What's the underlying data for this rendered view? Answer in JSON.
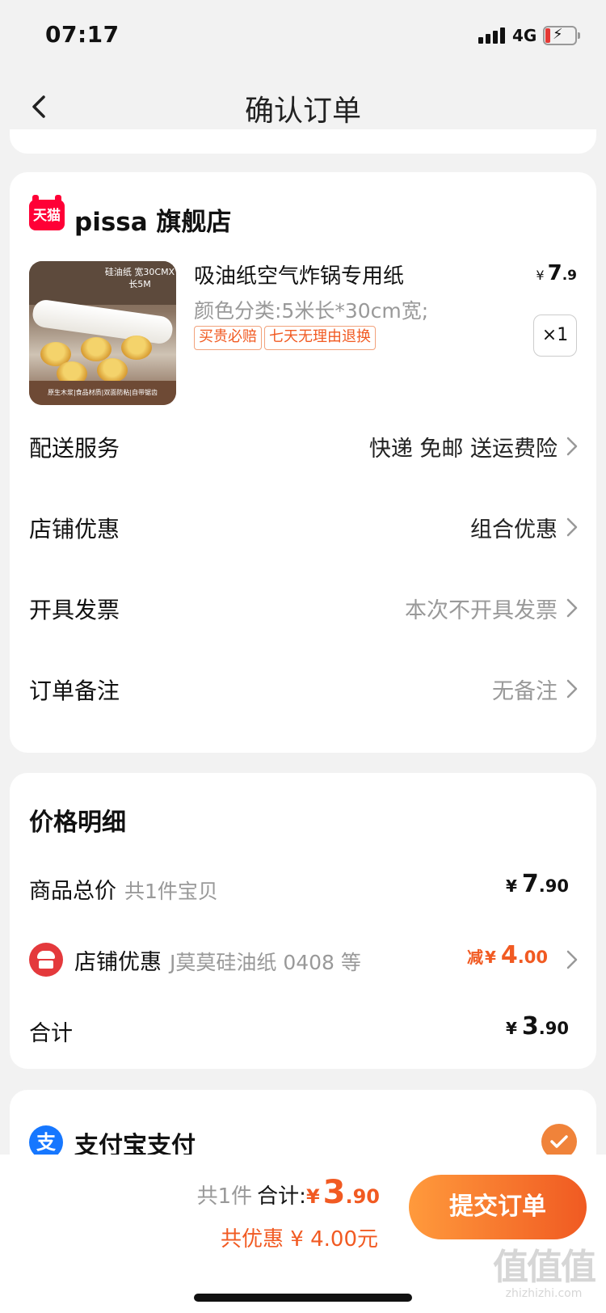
{
  "status_bar": {
    "time": "07:17",
    "network": "4G"
  },
  "nav": {
    "title": "确认订单"
  },
  "shop": {
    "logo_text": "天猫",
    "name": "pissa 旗舰店",
    "product": {
      "image_band_text": "硅油纸 宽30CMX长5M",
      "image_footer_text": "原生木浆|食品材质|双面防粘|自带锯齿",
      "title": "吸油纸空气炸锅专用纸",
      "spec": "颜色分类:5米长*30cm宽;",
      "tags": [
        "买贵必赔",
        "七天无理由退换"
      ],
      "price_symbol": "¥",
      "price_int": "7",
      "price_dec": ".9",
      "quantity": "×1"
    },
    "rows": [
      {
        "label": "配送服务",
        "value": "快递 免邮 送运费险",
        "value_color": "#222222"
      },
      {
        "label": "店铺优惠",
        "value": "组合优惠",
        "value_color": "#222222"
      },
      {
        "label": "开具发票",
        "value": "本次不开具发票",
        "value_color": "#999999"
      },
      {
        "label": "订单备注",
        "value": "无备注",
        "value_color": "#999999"
      }
    ]
  },
  "price_detail": {
    "title": "价格明细",
    "goods_total": {
      "label": "商品总价",
      "sub": "共1件宝贝",
      "symbol": "¥",
      "int": "7",
      "dec": ".90"
    },
    "shop_discount": {
      "label": "店铺优惠",
      "sub": "J莫莫硅油纸 0408 等",
      "prefix": "减",
      "symbol": "¥",
      "int": "4",
      "dec": ".00"
    },
    "total": {
      "label": "合计",
      "symbol": "¥",
      "int": "3",
      "dec": ".90"
    }
  },
  "payment": {
    "icon_text": "支",
    "label": "支付宝支付",
    "selected": true
  },
  "bottom_bar": {
    "count": "共1件",
    "sum_label": "合计:",
    "symbol": "¥",
    "int": "3",
    "dec": ".90",
    "discount_text": "共优惠 ¥ 4.00元",
    "submit_label": "提交订单"
  },
  "watermark": {
    "big": "值值值",
    "small": "zhizhizhi.com"
  },
  "colors": {
    "accent": "#f15a22",
    "tmall": "#ff0036",
    "alipay": "#1677ff",
    "background": "#f2f2f2"
  }
}
